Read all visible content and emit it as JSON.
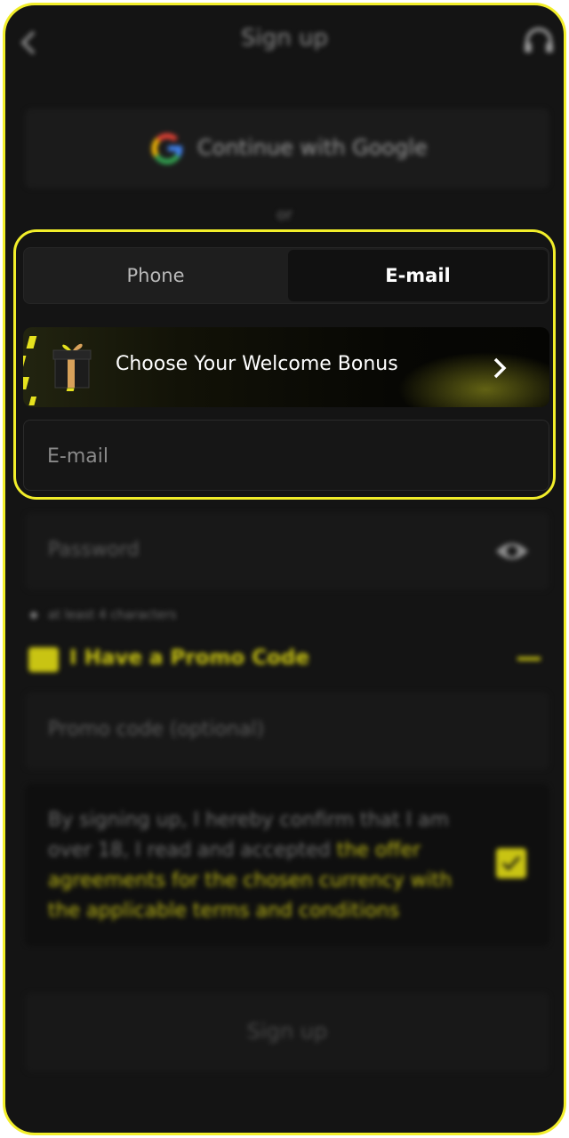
{
  "header": {
    "title": "Sign up"
  },
  "google": {
    "label": "Continue with Google"
  },
  "divider": {
    "text": "or"
  },
  "tabs": [
    {
      "label": "Phone",
      "active": false
    },
    {
      "label": "E-mail",
      "active": true
    }
  ],
  "bonus": {
    "label": "Choose Your Welcome Bonus"
  },
  "email": {
    "placeholder": "E-mail"
  },
  "password": {
    "placeholder": "Password",
    "hint": "at least 4 characters"
  },
  "promo": {
    "title": "I Have a Promo Code",
    "placeholder": "Promo code (optional)"
  },
  "terms": {
    "text": "By signing up, I hereby confirm that I am over 18, I read and accepted ",
    "link": "the offer agreements for the chosen currency with the applicable terms and conditions",
    "checked": true
  },
  "submit": {
    "label": "Sign up"
  },
  "colors": {
    "accent": "#f2ee2a",
    "background": "#141414"
  }
}
